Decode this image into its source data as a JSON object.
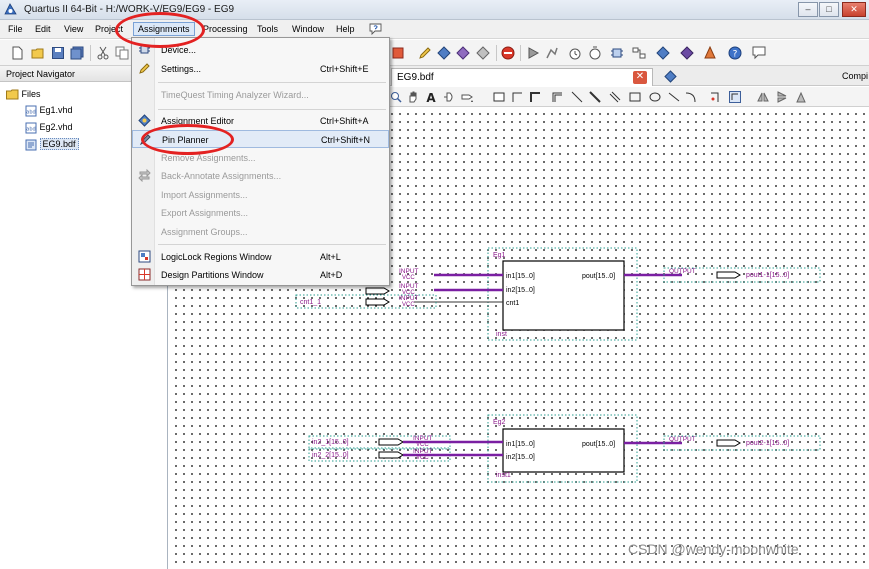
{
  "window": {
    "title": "Quartus II 64-Bit - H:/WORK-V/EG9/EG9 - EG9",
    "controls": [
      "minimize",
      "maximize",
      "close"
    ]
  },
  "menubar": {
    "items": [
      "File",
      "Edit",
      "View",
      "Project",
      "Assignments",
      "Processing",
      "Tools",
      "Window",
      "Help"
    ],
    "active": "Assignments"
  },
  "navigator": {
    "title": "Project Navigator",
    "folder": "Files",
    "files": [
      "Eg1.vhd",
      "Eg2.vhd",
      "EG9.bdf"
    ],
    "selected": "EG9.bdf"
  },
  "tabs": {
    "active_tab": "EG9.bdf",
    "second_tab": "Compi"
  },
  "assignments_menu": [
    {
      "label": "Device...",
      "shortcut": "",
      "enabled": true,
      "icon": "device-icon"
    },
    {
      "label": "Settings...",
      "shortcut": "Ctrl+Shift+E",
      "enabled": true,
      "icon": "settings-icon"
    },
    {
      "separator": true
    },
    {
      "label": "TimeQuest Timing Analyzer Wizard...",
      "shortcut": "",
      "enabled": false,
      "icon": ""
    },
    {
      "separator": true
    },
    {
      "label": "Assignment Editor",
      "shortcut": "Ctrl+Shift+A",
      "enabled": true,
      "icon": "assignment-editor-icon"
    },
    {
      "label": "Pin Planner",
      "shortcut": "Ctrl+Shift+N",
      "enabled": true,
      "icon": "pin-planner-icon",
      "highlighted": true
    },
    {
      "label": "Remove Assignments...",
      "shortcut": "",
      "enabled": false,
      "icon": ""
    },
    {
      "label": "Back-Annotate Assignments...",
      "shortcut": "",
      "enabled": false,
      "icon": "back-annotate-icon"
    },
    {
      "label": "Import Assignments...",
      "shortcut": "",
      "enabled": false,
      "icon": ""
    },
    {
      "label": "Export Assignments...",
      "shortcut": "",
      "enabled": false,
      "icon": ""
    },
    {
      "label": "Assignment Groups...",
      "shortcut": "",
      "enabled": false,
      "icon": ""
    },
    {
      "separator": true
    },
    {
      "label": "LogicLock Regions Window",
      "shortcut": "Alt+L",
      "enabled": true,
      "icon": "logiclock-icon"
    },
    {
      "label": "Design Partitions Window",
      "shortcut": "Alt+D",
      "enabled": true,
      "icon": "design-partitions-icon"
    }
  ],
  "schematic": {
    "block1": {
      "name": "Eg1",
      "inst": "inst",
      "ports_in": [
        "in1[15..0]",
        "in2[15..0]",
        "cnt1"
      ],
      "port_out": "pout[15..0]"
    },
    "block2": {
      "name": "Eg2",
      "inst": "inst1",
      "ports_in": [
        "in1[15..0]",
        "in2[15..0]"
      ],
      "port_out": "pout[15..0]"
    },
    "input_tag": "INPUT",
    "vcc_tag": "VCC",
    "output_tag": "OUTPUT",
    "block1_partial_inputs": [
      "cnt1_1"
    ],
    "block2_inputs": [
      "in2_1[15..0]",
      "in2_2[15..0]"
    ],
    "block1_output": "pout1-1[15..0]",
    "block2_output": "pout2-1[15..0]"
  },
  "colors": {
    "bus": "#7a1fa2",
    "symbol_text": "#8b1a8b",
    "highlight": "#e32222"
  },
  "watermark": "CSDN @wendy-moonwhite"
}
